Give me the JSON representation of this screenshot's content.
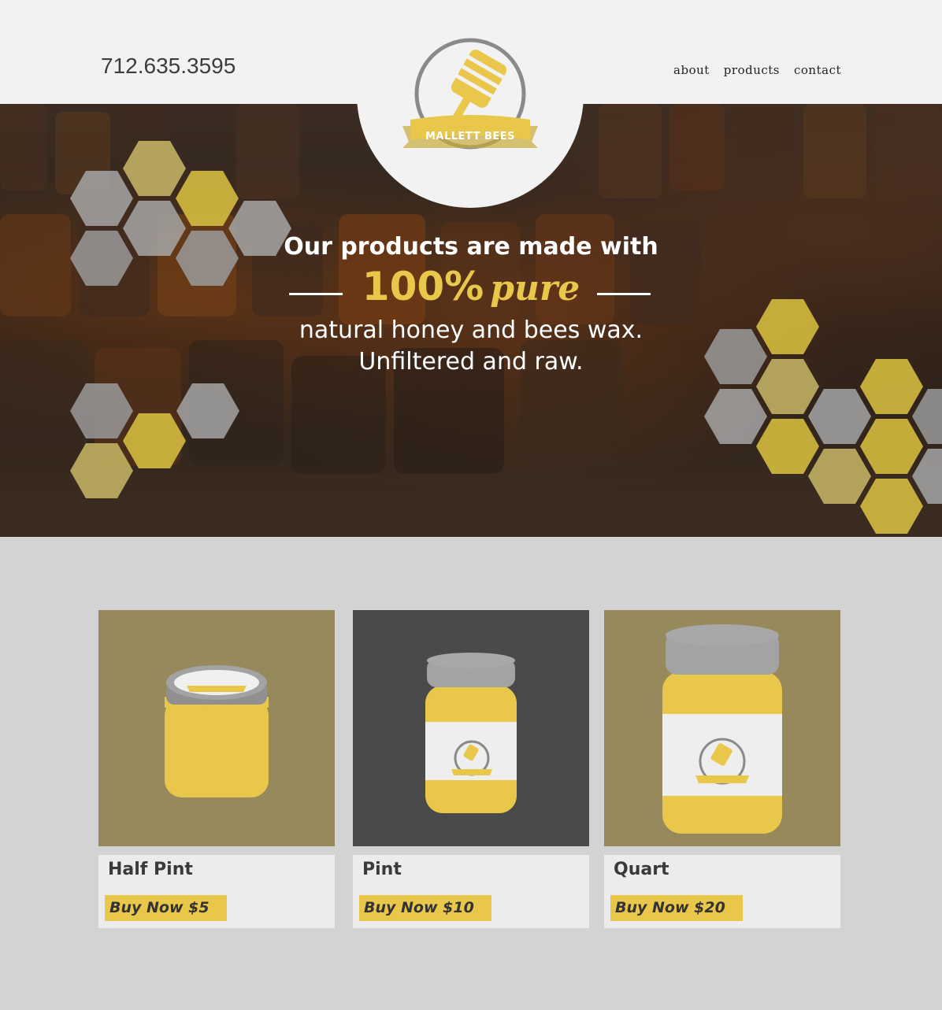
{
  "header": {
    "phone": "712.635.3595",
    "nav": [
      "about",
      "products",
      "contact"
    ],
    "logo_text": "MALLETT BEES"
  },
  "hero": {
    "line1": "Our products are made with",
    "pct": "100%",
    "pure": "pure",
    "line3": "natural honey and bees wax.",
    "line4": "Unfiltered and raw."
  },
  "products": [
    {
      "name": "Half Pint",
      "buy": "Buy Now $5"
    },
    {
      "name": "Pint",
      "buy": "Buy Now $10"
    },
    {
      "name": "Quart",
      "buy": "Buy Now $20"
    }
  ],
  "colors": {
    "honey": "#e9c74a",
    "olive": "#968a5c",
    "charcoal": "#4a4a4a",
    "lid": "#a3a3a3"
  }
}
